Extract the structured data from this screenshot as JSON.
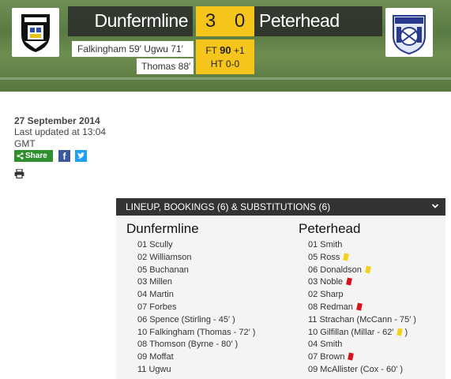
{
  "match": {
    "home_team": "Dunfermline",
    "away_team": "Peterhead",
    "home_score": "3",
    "away_score": "0",
    "home_crest_icon": "dunfermline-crest-icon",
    "away_crest_icon": "peterhead-crest-icon",
    "status": {
      "ft_label": "FT",
      "minutes": "90",
      "added": "+1",
      "half_time": "HT 0-0"
    },
    "home_scorers_line1": "Falkingham 59′   Ugwu 71′",
    "home_scorers_line2": "Thomas 88′"
  },
  "info": {
    "date": "27 September 2014",
    "updated": "Last updated at 13:04 GMT",
    "share_label": "Share",
    "facebook_label": "f"
  },
  "lineup": {
    "header": "LINEUP, BOOKINGS (6) & SUBSTITUTIONS (6)",
    "home": {
      "title": "Dunfermline",
      "players": [
        {
          "text": "01 Scully"
        },
        {
          "text": "02 Williamson"
        },
        {
          "text": "05 Buchanan"
        },
        {
          "text": "03 Millen"
        },
        {
          "text": "04 Martin"
        },
        {
          "text": "07 Forbes"
        },
        {
          "text": "06 Spence (Stirling - 45′ )"
        },
        {
          "text": "10 Falkingham (Thomas - 72′ )"
        },
        {
          "text": "08 Thomson (Byrne - 80′ )"
        },
        {
          "text": "09 Moffat"
        },
        {
          "text": "11 Ugwu"
        }
      ]
    },
    "away": {
      "title": "Peterhead",
      "players": [
        {
          "text": "01 Smith",
          "card": ""
        },
        {
          "text": "05 Ross",
          "card": "yellow"
        },
        {
          "text": "06 Donaldson",
          "card": "yellow"
        },
        {
          "text": "03 Noble",
          "card": "red"
        },
        {
          "text": "02 Sharp",
          "card": ""
        },
        {
          "text": "08 Redman",
          "card": "red"
        },
        {
          "text": "11 Strachan (McCann - 75′ )",
          "card": ""
        },
        {
          "text": "10 Gilfillan (Millar - 62′",
          "card": "yellow",
          "suffix": ")"
        },
        {
          "text": "04 Smith",
          "card": ""
        },
        {
          "text": "07 Brown",
          "card": "red"
        },
        {
          "text": "09 McAllister (Cox - 60′ )",
          "card": ""
        }
      ]
    }
  },
  "colors": {
    "score_bg": "#f6c51b",
    "bar_bg": "#333333",
    "share_green": "#2f8f2f",
    "yellow_card": "#f3d21a",
    "red_card": "#d7141d"
  }
}
